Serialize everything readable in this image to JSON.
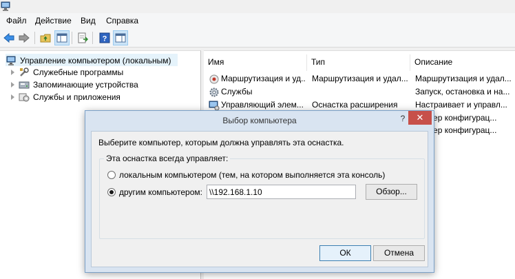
{
  "app": {
    "icon": "computer-management-icon"
  },
  "menu": {
    "items": [
      {
        "label": "Файл"
      },
      {
        "label": "Действие"
      },
      {
        "label": "Вид"
      },
      {
        "label": "Справка"
      }
    ]
  },
  "toolbar": {
    "icons": [
      "back-arrow-icon",
      "forward-arrow-icon",
      "up-folder-icon",
      "show-hide-tree-icon",
      "export-list-icon",
      "help-icon",
      "properties-icon"
    ]
  },
  "tree": {
    "root": {
      "label": "Управление компьютером (локальным)",
      "icon": "computer-management-icon"
    },
    "items": [
      {
        "label": "Служебные программы",
        "icon": "tools-icon"
      },
      {
        "label": "Запоминающие устройства",
        "icon": "storage-icon"
      },
      {
        "label": "Службы и приложения",
        "icon": "services-apps-icon"
      }
    ]
  },
  "list": {
    "columns": [
      {
        "label": "Имя"
      },
      {
        "label": "Тип"
      },
      {
        "label": "Описание"
      }
    ],
    "rows": [
      {
        "name": "Маршрутизация и уд...",
        "type": "Маршрутизация и удал...",
        "description": "Маршрутизация и удал...",
        "icon": "routing-icon"
      },
      {
        "name": "Службы",
        "type": "",
        "description": "Запуск, остановка и на...",
        "icon": "services-gear-icon"
      },
      {
        "name": "Управляющий элем...",
        "type": "Оснастка расширения",
        "description": "Настраивает и управл...",
        "icon": "wmi-control-icon"
      },
      {
        "name": "",
        "type": "",
        "description": "етчер конфигурац...",
        "icon": ""
      },
      {
        "name": "",
        "type": "",
        "description": "етчер конфигурац...",
        "icon": ""
      }
    ]
  },
  "dialog": {
    "title": "Выбор компьютера",
    "help": "?",
    "close": "✕",
    "prompt": "Выберите компьютер, которым должна управлять эта оснастка.",
    "group_label": "Эта оснастка всегда управляет:",
    "radio_local": "локальным компьютером  (тем, на котором выполняется эта консоль)",
    "radio_remote": "другим компьютером:",
    "remote_selected": true,
    "computer_value": "\\\\192.168.1.10",
    "browse": "Обзор...",
    "ok": "ОК",
    "cancel": "Отмена"
  }
}
